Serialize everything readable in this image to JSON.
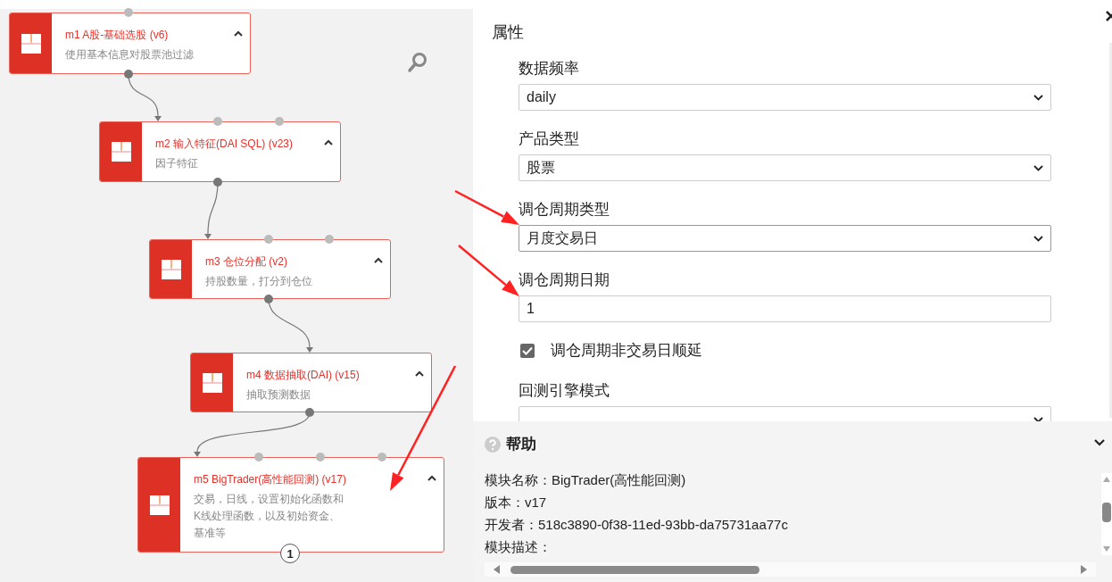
{
  "canvas": {
    "nodes": [
      {
        "title": "m1 A股-基础选股 (v6)",
        "description": "使用基本信息对股票池过滤"
      },
      {
        "title": "m2 输入特征(DAI SQL) (v23)",
        "description": "因子特征"
      },
      {
        "title": "m3 仓位分配 (v2)",
        "description": "持股数量，打分到仓位"
      },
      {
        "title": "m4 数据抽取(DAI) (v15)",
        "description": "抽取预测数据"
      },
      {
        "title": "m5 BigTrader(高性能回测) (v17)",
        "description": "交易，日线，设置初始化函数和K线处理函数，以及初始资金、基准等",
        "badge": "1"
      }
    ]
  },
  "properties": {
    "title": "属性",
    "fields": [
      {
        "kind": "select",
        "label": "数据频率",
        "value": "daily"
      },
      {
        "kind": "select",
        "label": "产品类型",
        "value": "股票"
      },
      {
        "kind": "select",
        "label": "调仓周期类型",
        "value": "月度交易日"
      },
      {
        "kind": "input",
        "label": "调仓周期日期",
        "value": "1"
      },
      {
        "kind": "checkbox",
        "label": "调仓周期非交易日顺延",
        "checked": true
      },
      {
        "kind": "select",
        "label": "回测引擎模式"
      }
    ]
  },
  "help": {
    "title": "帮助",
    "lines": [
      "模块名称：BigTrader(高性能回测)",
      "版本：v17",
      "开发者：518c3890-0f38-11ed-93bb-da75731aa77c",
      "模块描述："
    ]
  }
}
